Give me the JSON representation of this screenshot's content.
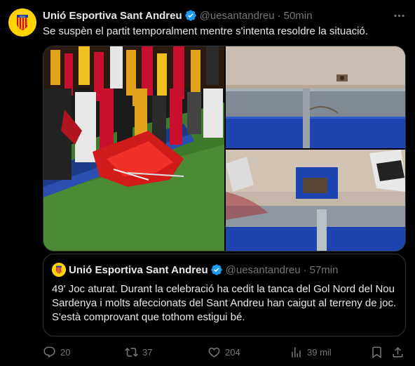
{
  "tweet": {
    "author_name": "Unió Esportiva Sant Andreu",
    "handle": "@uesantandreu",
    "time": "50min",
    "text": "Se suspèn el partit temporalment mentre s'intenta resoldre la situació."
  },
  "quoted_tweet": {
    "author_name": "Unió Esportiva Sant Andreu",
    "handle": "@uesantandreu",
    "time": "57min",
    "text": "49' Joc aturat. Durant la celebració ha cedit la tanca del Gol Nord del Nou Sardenya i molts afeccionats del Sant Andreu han caigut al terreny de joc. S'està comprovant que tothom estigui bé."
  },
  "actions": {
    "replies": "20",
    "retweets": "37",
    "likes": "204",
    "views": "39 mil"
  },
  "icons": {
    "verified": "verified-badge-icon",
    "more": "more-icon",
    "reply": "reply-icon",
    "retweet": "retweet-icon",
    "like": "heart-icon",
    "views": "views-icon",
    "bookmark": "bookmark-icon",
    "share": "share-icon"
  },
  "colors": {
    "background": "#000000",
    "text": "#e7e9ea",
    "muted": "#71767b",
    "verified": "#1d9bf0",
    "border": "#2f3336"
  }
}
